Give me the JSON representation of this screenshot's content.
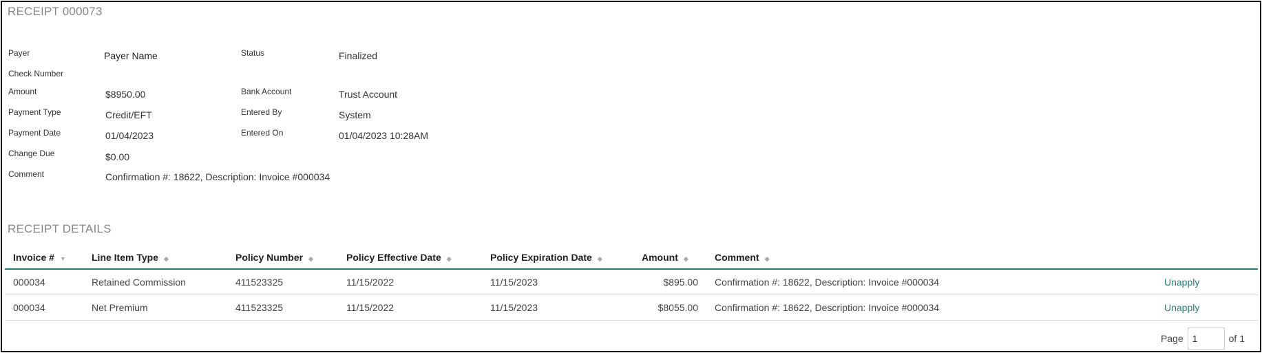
{
  "receipt": {
    "title": "RECEIPT 000073",
    "fields": {
      "payer_label": "Payer",
      "payer_value": "Payer Name",
      "status_label": "Status",
      "status_value": "Finalized",
      "check_number_label": "Check Number",
      "amount_label": "Amount",
      "amount_value": "$8950.00",
      "bank_account_label": "Bank Account",
      "bank_account_value": "Trust Account",
      "payment_type_label": "Payment Type",
      "payment_type_value": "Credit/EFT",
      "entered_by_label": "Entered By",
      "entered_by_value": "System",
      "payment_date_label": "Payment Date",
      "payment_date_value": "01/04/2023",
      "entered_on_label": "Entered On",
      "entered_on_value": "01/04/2023 10:28AM",
      "change_due_label": "Change Due",
      "change_due_value": "$0.00",
      "comment_label": "Comment",
      "comment_value": "Confirmation #: 18622, Description: Invoice #000034"
    }
  },
  "details": {
    "title": "RECEIPT DETAILS",
    "columns": [
      "Invoice #",
      "Line Item Type",
      "Policy Number",
      "Policy Effective Date",
      "Policy Expiration Date",
      "Amount",
      "Comment"
    ],
    "rows": [
      {
        "invoice": "000034",
        "line_item_type": "Retained Commission",
        "policy_number": "411523325",
        "effective_date": "11/15/2022",
        "expiration_date": "11/15/2023",
        "amount": "$895.00",
        "comment": "Confirmation #: 18622, Description: Invoice #000034",
        "action": "Unapply"
      },
      {
        "invoice": "000034",
        "line_item_type": "Net Premium",
        "policy_number": "411523325",
        "effective_date": "11/15/2022",
        "expiration_date": "11/15/2023",
        "amount": "$8055.00",
        "comment": "Confirmation #: 18622, Description: Invoice #000034",
        "action": "Unapply"
      }
    ]
  },
  "pager": {
    "page_label": "Page",
    "current_page": "1",
    "of_label": "of 1"
  },
  "colors": {
    "accent": "#2a7b72",
    "muted_title": "#888888"
  }
}
